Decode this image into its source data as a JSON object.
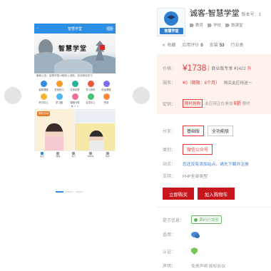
{
  "gallery": {
    "phone_header_title": "智慧学堂",
    "banner_title": "智慧学堂",
    "notice_text": "最新公告：智慧学堂小程序上线啦，欢迎体验学习",
    "grid_items": [
      {
        "label": "最新课程",
        "color": "#2f8de4"
      },
      {
        "label": "在线练习",
        "color": "#f39b2b"
      },
      {
        "label": "名师讲堂",
        "color": "#29b39a"
      },
      {
        "label": "学习资料",
        "color": "#e9573f"
      },
      {
        "label": "精品课程",
        "color": "#7a6ff0"
      },
      {
        "label": "考试中心",
        "color": "#f5b731"
      },
      {
        "label": "学习圈",
        "color": "#4fb8f0"
      },
      {
        "label": "课程分类",
        "color": "#ef6ea2"
      },
      {
        "label": "会员中心",
        "color": "#46c07a"
      },
      {
        "label": "签到",
        "color": "#ff8a3d"
      }
    ],
    "promo_badge": "限时活动",
    "tabs": [
      {
        "label": "首页",
        "active": true
      },
      {
        "label": "课程",
        "active": false
      },
      {
        "label": "练习",
        "active": false
      },
      {
        "label": "购物车",
        "active": false
      },
      {
        "label": "我的",
        "active": false
      }
    ]
  },
  "product": {
    "logo_text": "智慧学堂",
    "title": "诚客-智慧学堂",
    "version_label": "版本号：1",
    "tags": [
      "教育",
      "学校",
      "微课堂"
    ],
    "stats": {
      "favorite_label": "收藏",
      "rating_label": "应用评价",
      "rating_value": "0",
      "install_label": "安装",
      "install_value": "53",
      "industry_label": "行业类"
    },
    "price_label": "价格：",
    "price": "¥1738",
    "price_alt": "商业版专享 ¥1422",
    "price_alt_suffix": "升",
    "service_label": "服务：",
    "service_value": "¥0（期限：6个月）",
    "service_note": "购买此应用送一",
    "promo_label": "促销：",
    "promo_tag": "限时抢购",
    "promo_text": "此应用正在参加",
    "promo_discount": "8折",
    "promo_text2": "限时",
    "sku_label": "分支：",
    "sku_options": [
      "基础版",
      "全功能版"
    ],
    "category_label": "类别：",
    "category_value": "微信公众号",
    "site_label": "站点：",
    "site_text": "您还没有添加站点，请先下载并注册",
    "support_label": "支持：",
    "support_text": "PHP全部类型",
    "buy_button": "立即购买",
    "cart_button": "加入购物车",
    "hint_label": "提示信息：",
    "hint_badge": "源码已加密",
    "apply_label": "适用：",
    "cert_label": "认证：",
    "statement_label": "声明：",
    "statement_text": "免责声明  授权协议"
  }
}
